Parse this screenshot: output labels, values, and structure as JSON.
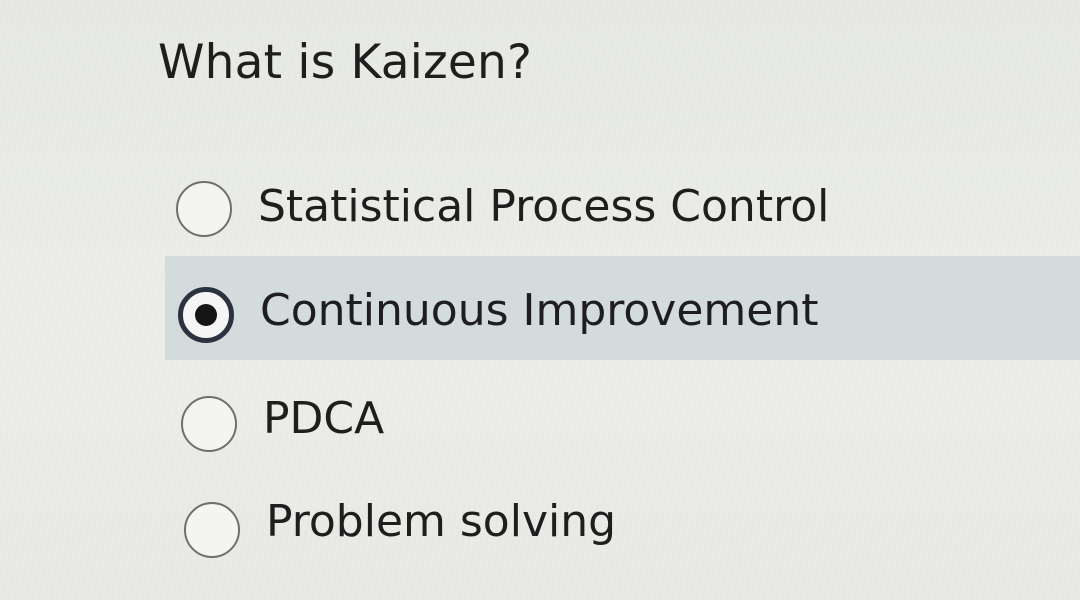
{
  "question": {
    "text": "What is Kaizen?"
  },
  "options": [
    {
      "label": "Statistical Process Control",
      "selected": false
    },
    {
      "label": "Continuous Improvement",
      "selected": true
    },
    {
      "label": "PDCA",
      "selected": false
    },
    {
      "label": "Problem solving",
      "selected": false
    }
  ]
}
